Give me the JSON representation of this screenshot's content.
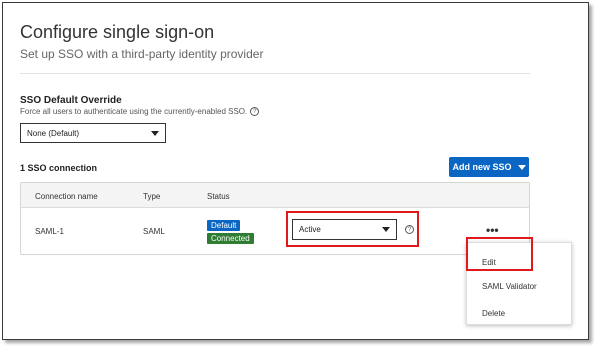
{
  "header": {
    "title": "Configure single sign-on",
    "subtitle": "Set up SSO with a third-party identity provider"
  },
  "override": {
    "title": "SSO Default Override",
    "description": "Force all users to authenticate using the currently-enabled SSO.",
    "help_icon": "?",
    "selected": "None (Default)"
  },
  "connections": {
    "count_label": "1 SSO connection",
    "add_button": "Add new SSO",
    "columns": [
      "Connection name",
      "Type",
      "Status"
    ],
    "rows": [
      {
        "name": "SAML-1",
        "type": "SAML",
        "badge_default": "Default",
        "badge_connected": "Connected",
        "status_value": "Active",
        "help_icon": "?",
        "more_icon": "•••"
      }
    ]
  },
  "context_menu": {
    "items": [
      "Edit",
      "SAML Validator",
      "Delete"
    ]
  },
  "colors": {
    "accent": "#0a66c2",
    "default_badge": "#0a66c2",
    "connected_badge": "#2e7d32",
    "highlight": "#e01a1a"
  }
}
